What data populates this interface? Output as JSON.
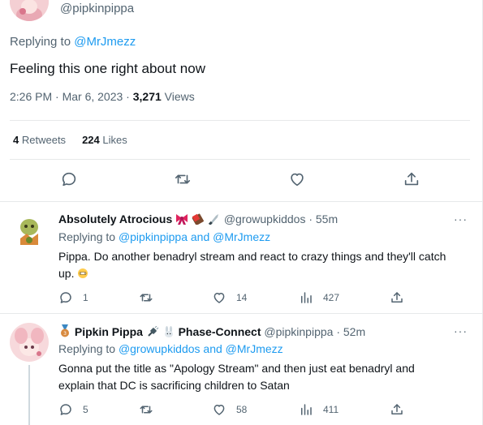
{
  "main_tweet": {
    "handle": "@pipkinpippa",
    "replying_to_label": "Replying to",
    "replying_to_user": "@MrJmezz",
    "text": "Feeling this one right about now",
    "time": "2:26 PM · Mar 6, 2023 · ",
    "views_count": "3,271",
    "views_label": " Views",
    "retweets_count": "4",
    "retweets_label": "Retweets",
    "likes_count": "224",
    "likes_label": "Likes"
  },
  "replies": [
    {
      "name": "Absolutely Atrocious",
      "emojis": [
        "ribbon",
        "chocolate-bar",
        "knife"
      ],
      "handle": "@growupkiddos · 55m",
      "replying_to_label": "Replying to",
      "replying_to_users": "@pipkinpippa and @MrJmezz",
      "text": "Pippa. Do another benadryl stream and react to crazy things and they'll catch up.",
      "reply_count": "1",
      "retweet_count": "",
      "like_count": "14",
      "view_count": "427"
    },
    {
      "badge": "third-place-medal",
      "name": "Pipkin Pippa",
      "emojis": [
        "plug",
        "rabbit"
      ],
      "name_suffix": "Phase-Connect",
      "handle": "@pipkinpippa · 52m",
      "replying_to_label": "Replying to",
      "replying_to_users": "@growupkiddos and @MrJmezz",
      "text": "Gonna put the title as \"Apology Stream\" and then just eat benadryl and explain that DC is sacrificing children to Satan",
      "reply_count": "5",
      "retweet_count": "",
      "like_count": "58",
      "view_count": "411"
    }
  ],
  "more_glyph": "···"
}
